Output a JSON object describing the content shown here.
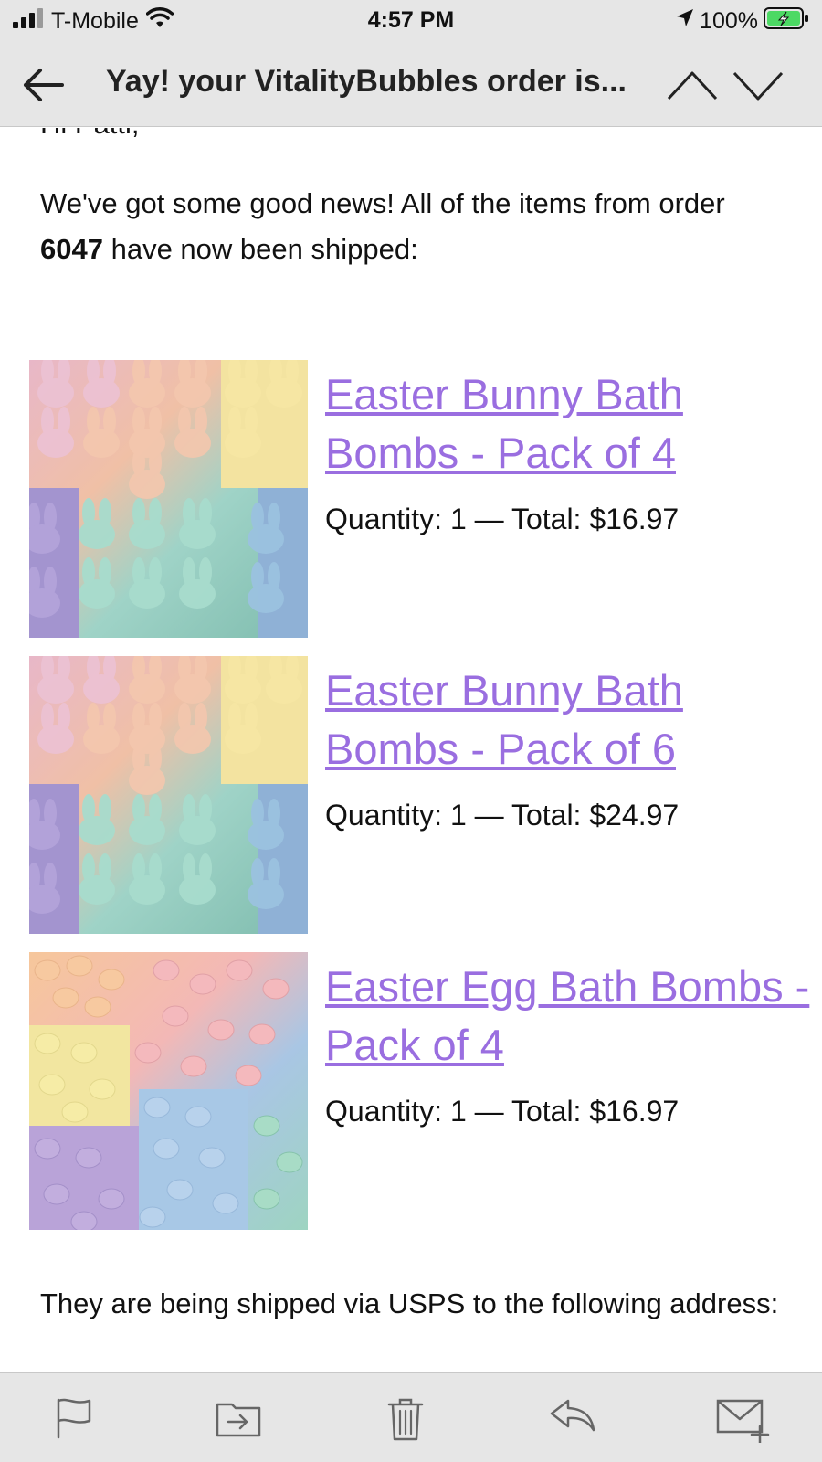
{
  "status_bar": {
    "carrier": "T-Mobile",
    "time": "4:57 PM",
    "battery": "100%",
    "icons": [
      "signal-icon",
      "wifi-icon",
      "location-icon",
      "battery-charging-icon"
    ]
  },
  "nav": {
    "title": "Yay! your VitalityBubbles order is...",
    "icons": [
      "back-arrow-icon",
      "chevron-up-icon",
      "chevron-down-icon"
    ]
  },
  "email": {
    "greeting": "Hi Patti,",
    "intro_line1": "We've got some good news! All of the items from order",
    "order_number": "6047",
    "intro_line2_rest": " have now been shipped:",
    "items": [
      {
        "name_line1": "Easter Bunny Bath",
        "name_line2": "Bombs - Pack of 4",
        "quantity_total": "Quantity: 1 — Total: $16.97"
      },
      {
        "name_line1": "Easter Bunny Bath",
        "name_line2": "Bombs - Pack of 6",
        "quantity_total": "Quantity: 1 — Total: $24.97"
      },
      {
        "name_line1": "Easter Egg Bath Bombs -",
        "name_line2": "Pack of 4",
        "quantity_total": "Quantity: 1 — Total: $16.97"
      }
    ],
    "shipping_text": "They are being shipped via USPS to the following address:"
  },
  "toolbar": {
    "icons": [
      "flag-icon",
      "move-folder-icon",
      "trash-icon",
      "reply-icon",
      "compose-icon"
    ]
  },
  "colors": {
    "link": "#9a6ee0",
    "bar_background": "#e6e6e6",
    "battery_green": "#4cd964"
  }
}
